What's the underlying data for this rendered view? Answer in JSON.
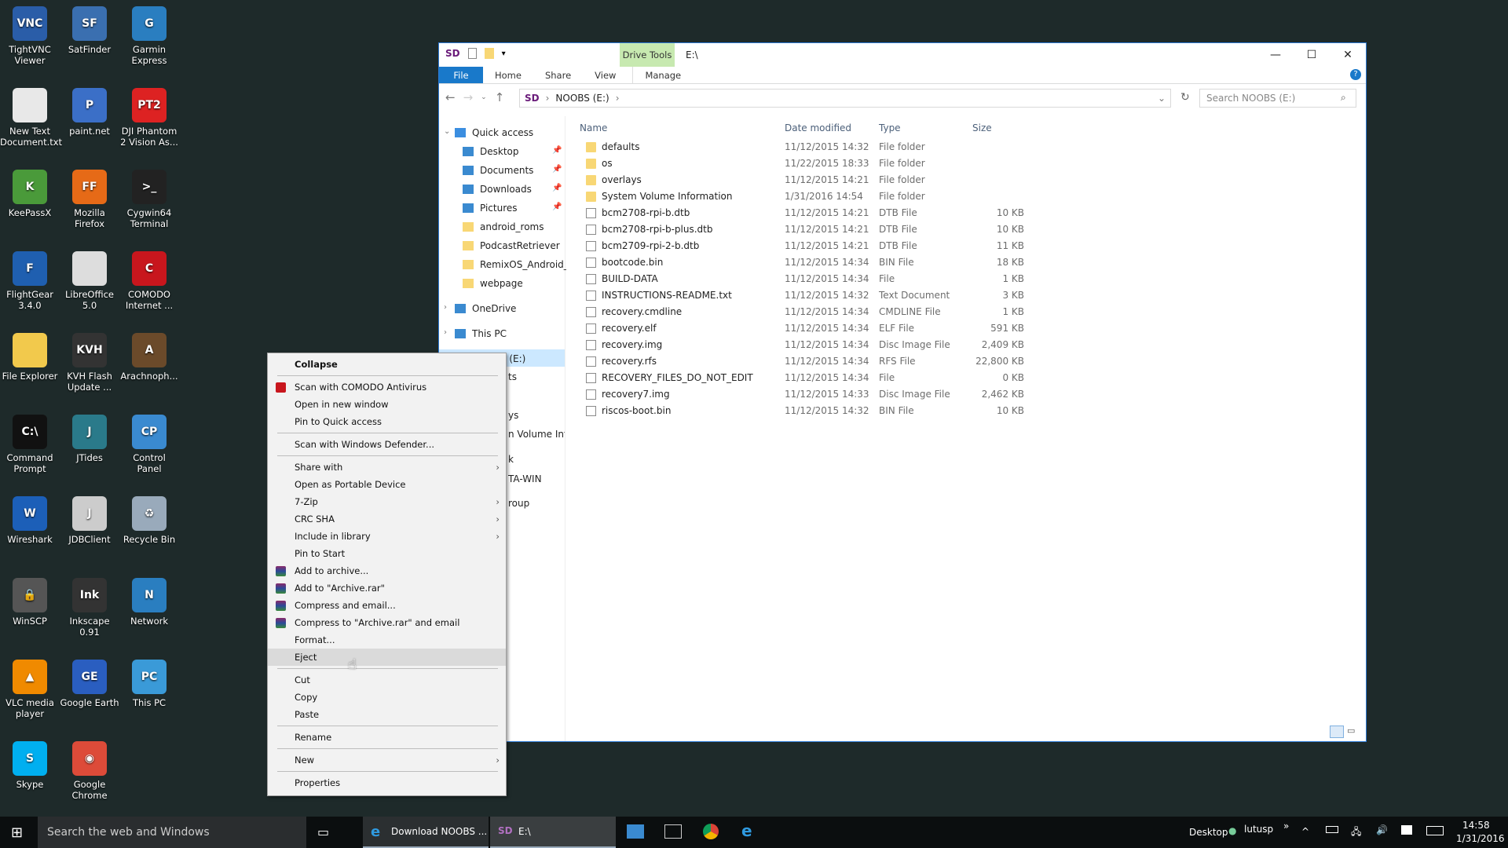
{
  "desktop": {
    "icons": [
      {
        "label": "TightVNC Viewer",
        "color": "#2a5da8",
        "glyph": "VNC"
      },
      {
        "label": "SatFinder",
        "color": "#3a6fb0",
        "glyph": "SF"
      },
      {
        "label": "Garmin Express",
        "color": "#2a7ec0",
        "glyph": "G"
      },
      {
        "label": "New Text Document.txt",
        "color": "#e8e8e8",
        "glyph": ""
      },
      {
        "label": "paint.net",
        "color": "#3b6fc7",
        "glyph": "P"
      },
      {
        "label": "DJI Phantom 2 Vision As...",
        "color": "#d22",
        "glyph": "PT2"
      },
      {
        "label": "KeePassX",
        "color": "#4a9a3a",
        "glyph": "K"
      },
      {
        "label": "Mozilla Firefox",
        "color": "#e66a17",
        "glyph": "FF"
      },
      {
        "label": "Cygwin64 Terminal",
        "color": "#222",
        "glyph": ">_"
      },
      {
        "label": "FlightGear 3.4.0",
        "color": "#1f5fb0",
        "glyph": "F"
      },
      {
        "label": "LibreOffice 5.0",
        "color": "#ddd",
        "glyph": ""
      },
      {
        "label": "COMODO Internet ...",
        "color": "#c8161d",
        "glyph": "C"
      },
      {
        "label": "File Explorer",
        "color": "#f2c94c",
        "glyph": ""
      },
      {
        "label": "KVH Flash Update ...",
        "color": "#333",
        "glyph": "KVH"
      },
      {
        "label": "Arachnoph...",
        "color": "#6b4a2a",
        "glyph": "A"
      },
      {
        "label": "Command Prompt",
        "color": "#111",
        "glyph": "C:\\"
      },
      {
        "label": "JTides",
        "color": "#2a7a8a",
        "glyph": "J"
      },
      {
        "label": "Control Panel",
        "color": "#3a8ad0",
        "glyph": "CP"
      },
      {
        "label": "Wireshark",
        "color": "#1c5fb8",
        "glyph": "W"
      },
      {
        "label": "JDBClient",
        "color": "#ccc",
        "glyph": "J"
      },
      {
        "label": "Recycle Bin",
        "color": "#9ab",
        "glyph": "♻"
      },
      {
        "label": "WinSCP",
        "color": "#555",
        "glyph": "🔒"
      },
      {
        "label": "Inkscape 0.91",
        "color": "#333",
        "glyph": "Ink"
      },
      {
        "label": "Network",
        "color": "#2a7ec0",
        "glyph": "N"
      },
      {
        "label": "VLC media player",
        "color": "#f08a00",
        "glyph": "▲"
      },
      {
        "label": "Google Earth",
        "color": "#2a5ec0",
        "glyph": "GE"
      },
      {
        "label": "This PC",
        "color": "#3a9ad8",
        "glyph": "PC"
      },
      {
        "label": "Skype",
        "color": "#00aff0",
        "glyph": "S"
      },
      {
        "label": "Google Chrome",
        "color": "#dd4b39",
        "glyph": "◉"
      }
    ]
  },
  "window": {
    "title": "E:\\",
    "drive_tools": "Drive Tools",
    "ribbon_tabs": [
      "File",
      "Home",
      "Share",
      "View",
      "Manage"
    ],
    "breadcrumb": [
      "NOOBS (E:)"
    ],
    "search_placeholder": "Search NOOBS (E:)",
    "controls": {
      "minimize": "—",
      "maximize": "☐",
      "close": "✕"
    },
    "nav": [
      {
        "label": "Quick access",
        "icon": "star-icon",
        "pinned": false
      },
      {
        "label": "Desktop",
        "icon": "desktop-icon",
        "pinned": true
      },
      {
        "label": "Documents",
        "icon": "documents-icon",
        "pinned": true
      },
      {
        "label": "Downloads",
        "icon": "downloads-icon",
        "pinned": true
      },
      {
        "label": "Pictures",
        "icon": "pictures-icon",
        "pinned": true
      },
      {
        "label": "android_roms",
        "icon": "folder-icon"
      },
      {
        "label": "PodcastRetriever",
        "icon": "folder-icon"
      },
      {
        "label": "RemixOS_Android_f",
        "icon": "folder-icon"
      },
      {
        "label": "webpage",
        "icon": "folder-icon"
      },
      {
        "label": "OneDrive",
        "icon": "cloud-icon"
      },
      {
        "label": "This PC",
        "icon": "pc-icon"
      },
      {
        "label": "NOOBS (E:)",
        "icon": "sd-icon"
      }
    ],
    "nav_fragments": [
      "ts",
      "ys",
      "n Volume Infc",
      "k",
      "TA-WIN",
      "roup"
    ],
    "columns": [
      "Name",
      "Date modified",
      "Type",
      "Size"
    ],
    "files": [
      {
        "name": "defaults",
        "date": "11/12/2015 14:32",
        "type": "File folder",
        "size": "",
        "kind": "folder"
      },
      {
        "name": "os",
        "date": "11/22/2015 18:33",
        "type": "File folder",
        "size": "",
        "kind": "folder"
      },
      {
        "name": "overlays",
        "date": "11/12/2015 14:21",
        "type": "File folder",
        "size": "",
        "kind": "folder"
      },
      {
        "name": "System Volume Information",
        "date": "1/31/2016 14:54",
        "type": "File folder",
        "size": "",
        "kind": "folder"
      },
      {
        "name": "bcm2708-rpi-b.dtb",
        "date": "11/12/2015 14:21",
        "type": "DTB File",
        "size": "10 KB",
        "kind": "file"
      },
      {
        "name": "bcm2708-rpi-b-plus.dtb",
        "date": "11/12/2015 14:21",
        "type": "DTB File",
        "size": "10 KB",
        "kind": "file"
      },
      {
        "name": "bcm2709-rpi-2-b.dtb",
        "date": "11/12/2015 14:21",
        "type": "DTB File",
        "size": "11 KB",
        "kind": "file"
      },
      {
        "name": "bootcode.bin",
        "date": "11/12/2015 14:34",
        "type": "BIN File",
        "size": "18 KB",
        "kind": "file"
      },
      {
        "name": "BUILD-DATA",
        "date": "11/12/2015 14:34",
        "type": "File",
        "size": "1 KB",
        "kind": "file"
      },
      {
        "name": "INSTRUCTIONS-README.txt",
        "date": "11/12/2015 14:32",
        "type": "Text Document",
        "size": "3 KB",
        "kind": "file"
      },
      {
        "name": "recovery.cmdline",
        "date": "11/12/2015 14:34",
        "type": "CMDLINE File",
        "size": "1 KB",
        "kind": "file"
      },
      {
        "name": "recovery.elf",
        "date": "11/12/2015 14:34",
        "type": "ELF File",
        "size": "591 KB",
        "kind": "file"
      },
      {
        "name": "recovery.img",
        "date": "11/12/2015 14:34",
        "type": "Disc Image File",
        "size": "2,409 KB",
        "kind": "file"
      },
      {
        "name": "recovery.rfs",
        "date": "11/12/2015 14:34",
        "type": "RFS File",
        "size": "22,800 KB",
        "kind": "file"
      },
      {
        "name": "RECOVERY_FILES_DO_NOT_EDIT",
        "date": "11/12/2015 14:34",
        "type": "File",
        "size": "0 KB",
        "kind": "file"
      },
      {
        "name": "recovery7.img",
        "date": "11/12/2015 14:33",
        "type": "Disc Image File",
        "size": "2,462 KB",
        "kind": "file"
      },
      {
        "name": "riscos-boot.bin",
        "date": "11/12/2015 14:32",
        "type": "BIN File",
        "size": "10 KB",
        "kind": "file"
      }
    ]
  },
  "context_menu": [
    {
      "label": "Collapse",
      "bold": true
    },
    {
      "sep": true
    },
    {
      "label": "Scan with COMODO Antivirus",
      "icon": "comodo-icon"
    },
    {
      "label": "Open in new window"
    },
    {
      "label": "Pin to Quick access"
    },
    {
      "sep": true
    },
    {
      "label": "Scan with Windows Defender..."
    },
    {
      "sep": true
    },
    {
      "label": "Share with",
      "submenu": true
    },
    {
      "label": "Open as Portable Device"
    },
    {
      "label": "7-Zip",
      "submenu": true
    },
    {
      "label": "CRC SHA",
      "submenu": true
    },
    {
      "label": "Include in library",
      "submenu": true
    },
    {
      "label": "Pin to Start"
    },
    {
      "label": "Add to archive...",
      "icon": "winrar-icon"
    },
    {
      "label": "Add to \"Archive.rar\"",
      "icon": "winrar-icon"
    },
    {
      "label": "Compress and email...",
      "icon": "winrar-icon"
    },
    {
      "label": "Compress to \"Archive.rar\" and email",
      "icon": "winrar-icon"
    },
    {
      "label": "Format..."
    },
    {
      "label": "Eject",
      "highlighted": true
    },
    {
      "sep": true
    },
    {
      "label": "Cut"
    },
    {
      "label": "Copy"
    },
    {
      "label": "Paste"
    },
    {
      "sep": true
    },
    {
      "label": "Rename"
    },
    {
      "sep": true
    },
    {
      "label": "New",
      "submenu": true
    },
    {
      "sep": true
    },
    {
      "label": "Properties"
    }
  ],
  "taskbar": {
    "search_placeholder": "Search the web and Windows",
    "apps": [
      {
        "label": "Download NOOBS ..."
      },
      {
        "label": "E:\\"
      }
    ],
    "desktop_label": "Desktop",
    "user": "lutusp",
    "more": "»",
    "time": "14:58",
    "date": "1/31/2016"
  },
  "colors": {
    "accent": "#1979ca",
    "drive_tools": "#c7e9b0",
    "selection": "#cce8ff",
    "desktop": "#1e2a2a"
  }
}
